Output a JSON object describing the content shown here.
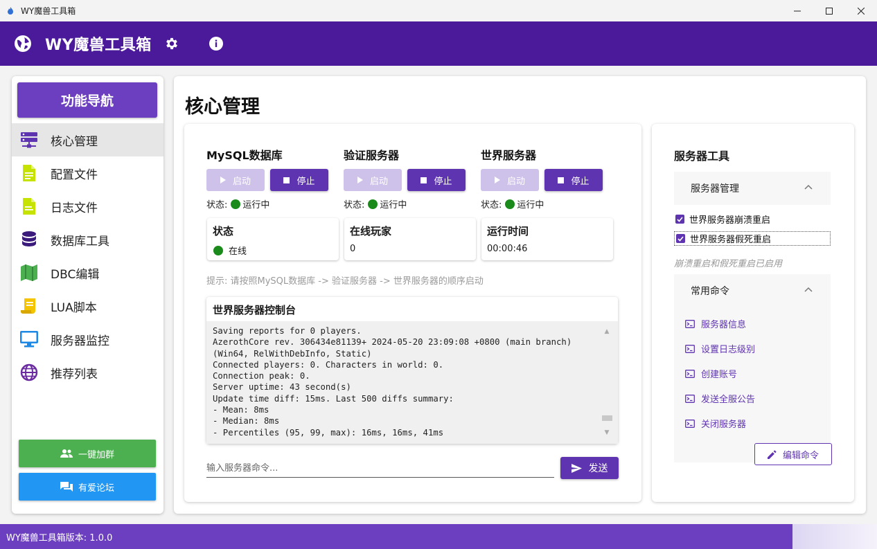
{
  "window": {
    "title": "WY魔兽工具箱"
  },
  "appbar": {
    "title": "WY魔兽工具箱"
  },
  "sidebar": {
    "header": "功能导航",
    "items": [
      {
        "label": "核心管理",
        "icon": "server-icon",
        "color": "#5f34b0"
      },
      {
        "label": "配置文件",
        "icon": "file-icon",
        "color": "#c6e200"
      },
      {
        "label": "日志文件",
        "icon": "log-file-icon",
        "color": "#c6e200"
      },
      {
        "label": "数据库工具",
        "icon": "database-icon",
        "color": "#3a1a7a"
      },
      {
        "label": "DBC编辑",
        "icon": "map-icon",
        "color": "#4caf50"
      },
      {
        "label": "LUA脚本",
        "icon": "script-icon",
        "color": "#f5c400"
      },
      {
        "label": "服务器监控",
        "icon": "monitor-icon",
        "color": "#1e88e5"
      },
      {
        "label": "推荐列表",
        "icon": "globe-icon",
        "color": "#6a2ba0"
      }
    ],
    "join_button": "一键加群",
    "forum_button": "有爱论坛"
  },
  "main": {
    "title": "核心管理",
    "services": [
      {
        "name": "MySQL数据库",
        "start": "启动",
        "stop": "停止",
        "status_label": "状态:",
        "status_value": "运行中"
      },
      {
        "name": "验证服务器",
        "start": "启动",
        "stop": "停止",
        "status_label": "状态:",
        "status_value": "运行中"
      },
      {
        "name": "世界服务器",
        "start": "启动",
        "stop": "停止",
        "status_label": "状态:",
        "status_value": "运行中"
      }
    ],
    "stats": [
      {
        "title": "状态",
        "value": "在线"
      },
      {
        "title": "在线玩家",
        "value": "0"
      },
      {
        "title": "运行时间",
        "value": "00:00:46"
      }
    ],
    "hint": "提示: 请按照MySQL数据库 -> 验证服务器 -> 世界服务器的顺序启动",
    "console": {
      "title": "世界服务器控制台",
      "lines": [
        "Saving reports for 0 players.",
        "AzerothCore rev. 306434e81139+ 2024-05-20 23:09:08 +0800 (main branch)",
        "(Win64, RelWithDebInfo, Static)",
        "Connected players: 0. Characters in world: 0.",
        "Connection peak: 0.",
        "Server uptime: 43 second(s)",
        "Update time diff: 15ms. Last 500 diffs summary:",
        "- Mean: 8ms",
        "- Median: 8ms",
        "- Percentiles (95, 99, max): 16ms, 16ms, 41ms"
      ]
    },
    "command_placeholder": "输入服务器命令...",
    "send_button": "发送"
  },
  "tools": {
    "title": "服务器工具",
    "server_mgmt": {
      "header": "服务器管理",
      "options": [
        {
          "label": "世界服务器崩溃重启",
          "checked": true
        },
        {
          "label": "世界服务器假死重启",
          "checked": true
        }
      ],
      "hint": "崩溃重启和假死重启已启用"
    },
    "commands": {
      "header": "常用命令",
      "items": [
        "服务器信息",
        "设置日志级别",
        "创建账号",
        "发送全服公告",
        "关闭服务器"
      ],
      "edit_button": "编辑命令"
    }
  },
  "footer": {
    "version": "WY魔兽工具箱版本: 1.0.0"
  },
  "colors": {
    "header": "#4a1a9a",
    "accent": "#6b3fbf",
    "primary_button": "#5f34b0",
    "disabled_button": "#cfc2ea",
    "status_green": "#1a8a1a",
    "join": "#4caf50",
    "forum": "#2196f3"
  }
}
